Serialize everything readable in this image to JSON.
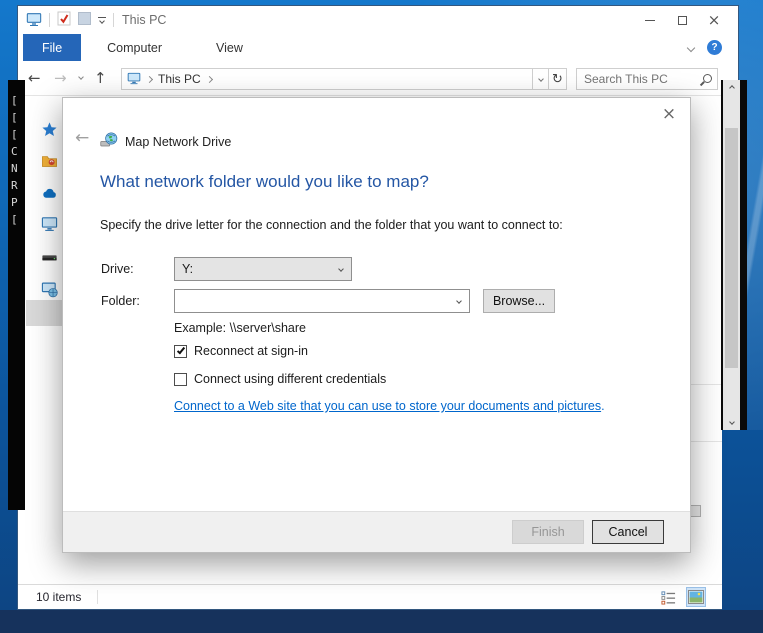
{
  "window": {
    "title": "This PC"
  },
  "ribbon": {
    "tabs": [
      "File",
      "Computer",
      "View"
    ]
  },
  "address_bar": {
    "location": "This PC",
    "search_placeholder": "Search This PC"
  },
  "status_bar": {
    "items_count": "10 items"
  },
  "console": {
    "lines": [
      "[",
      "[",
      "[",
      "C",
      "N",
      "R",
      "P",
      "["
    ]
  },
  "dialog": {
    "title": "Map Network Drive",
    "heading": "What network folder would you like to map?",
    "instruction": "Specify the drive letter for the connection and the folder that you want to connect to:",
    "drive_label": "Drive:",
    "drive_value": "Y:",
    "folder_label": "Folder:",
    "folder_value": "",
    "browse_button": "Browse...",
    "example": "Example: \\\\server\\share",
    "reconnect_checkbox": {
      "label": "Reconnect at sign-in",
      "checked": true
    },
    "credentials_checkbox": {
      "label": "Connect using different credentials",
      "checked": false
    },
    "link": "Connect to a Web site that you can use to store your documents and pictures",
    "link_period": ".",
    "finish_button": "Finish",
    "cancel_button": "Cancel"
  },
  "colors": {
    "heading_blue": "#2456a4",
    "link_blue": "#0066cc",
    "file_tab_blue": "#2566b8",
    "selection_gray": "#d9d9d9",
    "taskbar_navy": "#16325c"
  }
}
